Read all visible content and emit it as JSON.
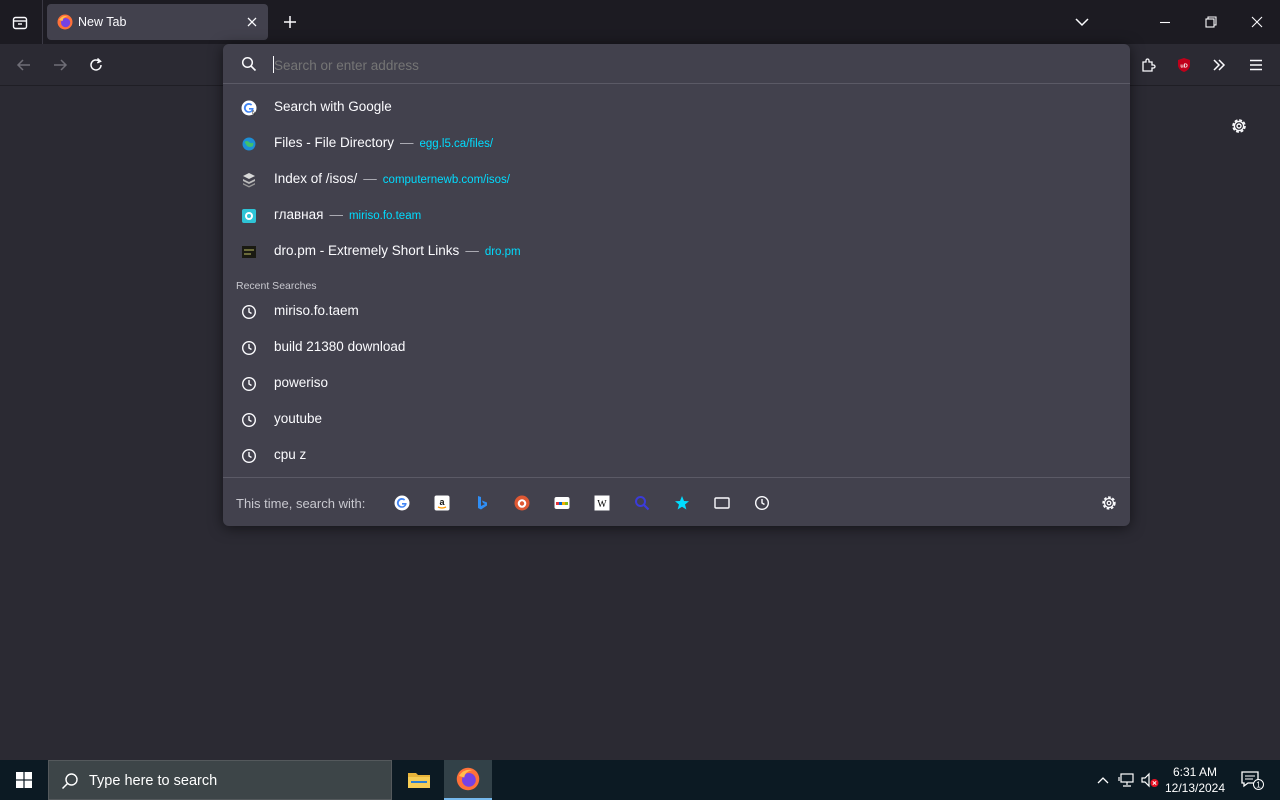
{
  "tabstrip": {
    "tab": {
      "title": "New Tab"
    }
  },
  "urlbar": {
    "placeholder": "Search or enter address",
    "suggestions": [
      {
        "title": "Search with Google",
        "url": ""
      },
      {
        "title": "Files - File Directory",
        "url": "egg.l5.ca/files/"
      },
      {
        "title": "Index of /isos/",
        "url": "computernewb.com/isos/"
      },
      {
        "title": "главная",
        "url": "miriso.fo.team"
      },
      {
        "title": "dro.pm - Extremely Short Links",
        "url": "dro.pm"
      }
    ],
    "separator": "—",
    "recent_label": "Recent Searches",
    "recent": [
      "miriso.fo.taem",
      "build 21380 download",
      "poweriso",
      "youtube",
      "cpu z"
    ],
    "footer_label": "This time, search with:",
    "engines": [
      "google-icon",
      "amazon-icon",
      "bing-icon",
      "duckduckgo-icon",
      "ebay-icon",
      "wikipedia-icon",
      "search-engine-icon",
      "bookmarks-icon",
      "tabs-icon",
      "history-icon"
    ]
  },
  "taskbar": {
    "search_placeholder": "Type here to search",
    "time": "6:31 AM",
    "date": "12/13/2024",
    "notification_count": "1"
  },
  "colors": {
    "accent": "#00ddff",
    "popup_bg": "#42414d",
    "page_bg": "#2b2a33",
    "tabstrip_bg": "#1c1b22"
  }
}
